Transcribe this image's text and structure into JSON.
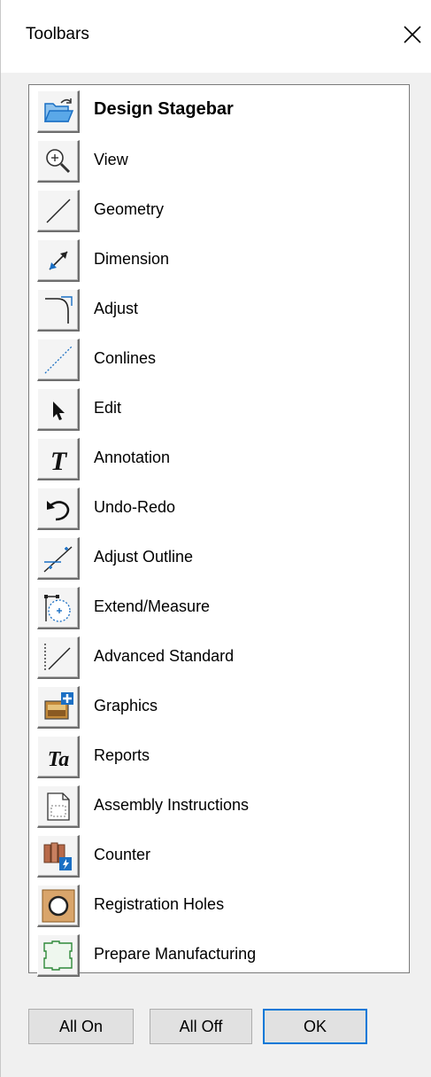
{
  "window": {
    "title": "Toolbars"
  },
  "toolbars": [
    {
      "label": "Design Stagebar",
      "icon": "folder-open-icon",
      "bold": true
    },
    {
      "label": "View",
      "icon": "zoom-icon"
    },
    {
      "label": "Geometry",
      "icon": "line-icon"
    },
    {
      "label": "Dimension",
      "icon": "dimension-arrow-icon"
    },
    {
      "label": "Adjust",
      "icon": "fillet-corner-icon"
    },
    {
      "label": "Conlines",
      "icon": "construction-line-icon"
    },
    {
      "label": "Edit",
      "icon": "pointer-arrow-icon"
    },
    {
      "label": "Annotation",
      "icon": "text-t-icon"
    },
    {
      "label": "Undo-Redo",
      "icon": "undo-icon"
    },
    {
      "label": "Adjust Outline",
      "icon": "adjust-outline-icon"
    },
    {
      "label": "Extend/Measure",
      "icon": "extend-measure-icon"
    },
    {
      "label": "Advanced Standard",
      "icon": "advanced-line-icon"
    },
    {
      "label": "Graphics",
      "icon": "graphics-add-icon"
    },
    {
      "label": "Reports",
      "icon": "text-ta-icon"
    },
    {
      "label": "Assembly Instructions",
      "icon": "document-icon"
    },
    {
      "label": "Counter",
      "icon": "counter-icon"
    },
    {
      "label": "Registration Holes",
      "icon": "registration-hole-icon"
    },
    {
      "label": "Prepare Manufacturing",
      "icon": "manufacturing-outline-icon"
    }
  ],
  "buttons": {
    "all_on": "All On",
    "all_off": "All Off",
    "ok": "OK"
  },
  "colors": {
    "default_button_border": "#0078d7",
    "icon_blue": "#1a6fc4"
  }
}
